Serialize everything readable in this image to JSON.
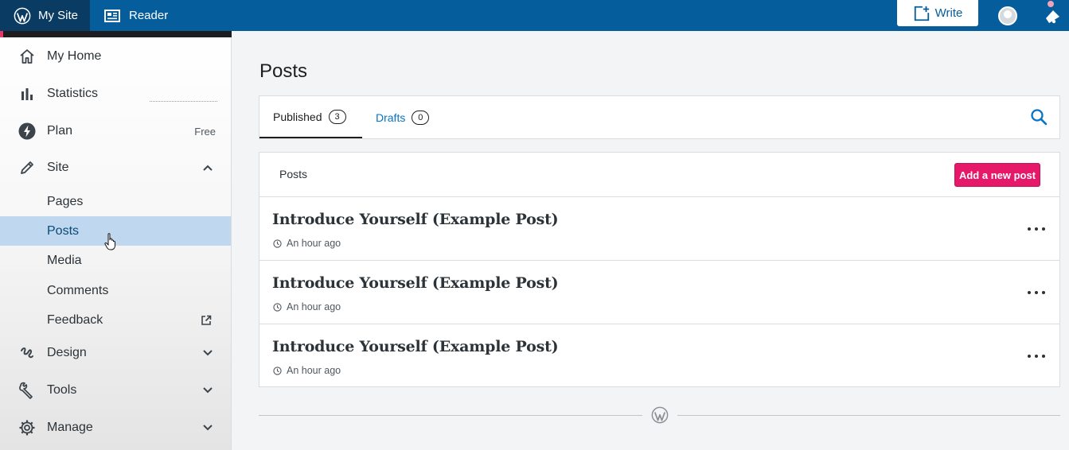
{
  "masterbar": {
    "my_site": "My Site",
    "reader": "Reader",
    "write": "Write"
  },
  "sidebar": {
    "items": [
      {
        "label": "My Home",
        "icon": "home-icon"
      },
      {
        "label": "Statistics",
        "icon": "bar-chart-icon"
      },
      {
        "label": "Plan",
        "icon": "lightning-icon",
        "badge": "Free"
      },
      {
        "label": "Site",
        "icon": "pencil-icon",
        "expanded": true
      }
    ],
    "site_subitems": [
      "Pages",
      "Posts",
      "Media",
      "Comments",
      "Feedback"
    ],
    "active_subitem": "Posts",
    "bottom_items": [
      {
        "label": "Design",
        "icon": "design-icon"
      },
      {
        "label": "Tools",
        "icon": "wrench-icon"
      },
      {
        "label": "Manage",
        "icon": "gear-icon"
      }
    ]
  },
  "main": {
    "title": "Posts",
    "tabs": [
      {
        "label": "Published",
        "count": "3",
        "selected": true
      },
      {
        "label": "Drafts",
        "count": "0",
        "selected": false
      }
    ],
    "list_header": "Posts",
    "add_button": "Add a new post",
    "posts": [
      {
        "title": "Introduce Yourself (Example Post)",
        "time": "An hour ago"
      },
      {
        "title": "Introduce Yourself (Example Post)",
        "time": "An hour ago"
      },
      {
        "title": "Introduce Yourself (Example Post)",
        "time": "An hour ago"
      }
    ]
  },
  "colors": {
    "masterbar": "#055d9c",
    "masterbar_active": "#0a3b63",
    "accent_pink": "#e6186a",
    "link_blue": "#0675c4",
    "active_row": "#bfd7ef"
  }
}
